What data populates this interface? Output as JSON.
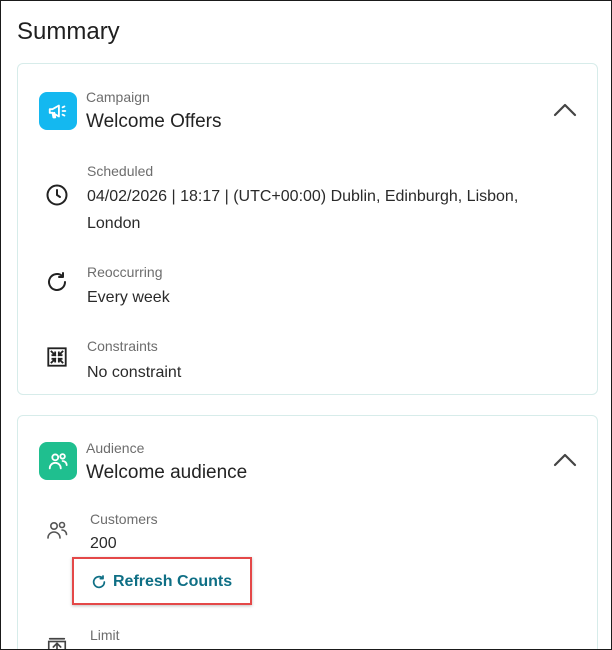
{
  "page": {
    "title": "Summary"
  },
  "campaign": {
    "kicker": "Campaign",
    "title": "Welcome Offers",
    "icon": "megaphone-icon",
    "accent": "#14b8f0",
    "scheduled": {
      "label": "Scheduled",
      "value": "04/02/2026 | 18:17 | (UTC+00:00) Dublin, Edinburgh, Lisbon, London"
    },
    "reoccurring": {
      "label": "Reoccurring",
      "value": "Every week"
    },
    "constraints": {
      "label": "Constraints",
      "value": "No constraint"
    }
  },
  "audience": {
    "kicker": "Audience",
    "title": "Welcome audience",
    "icon": "people-icon",
    "accent": "#1fbf8f",
    "customers": {
      "label": "Customers",
      "value": "200"
    },
    "refresh_label": "Refresh Counts",
    "limit": {
      "label": "Limit"
    }
  },
  "colors": {
    "link": "#0f6f85",
    "highlight": "#e44848"
  }
}
